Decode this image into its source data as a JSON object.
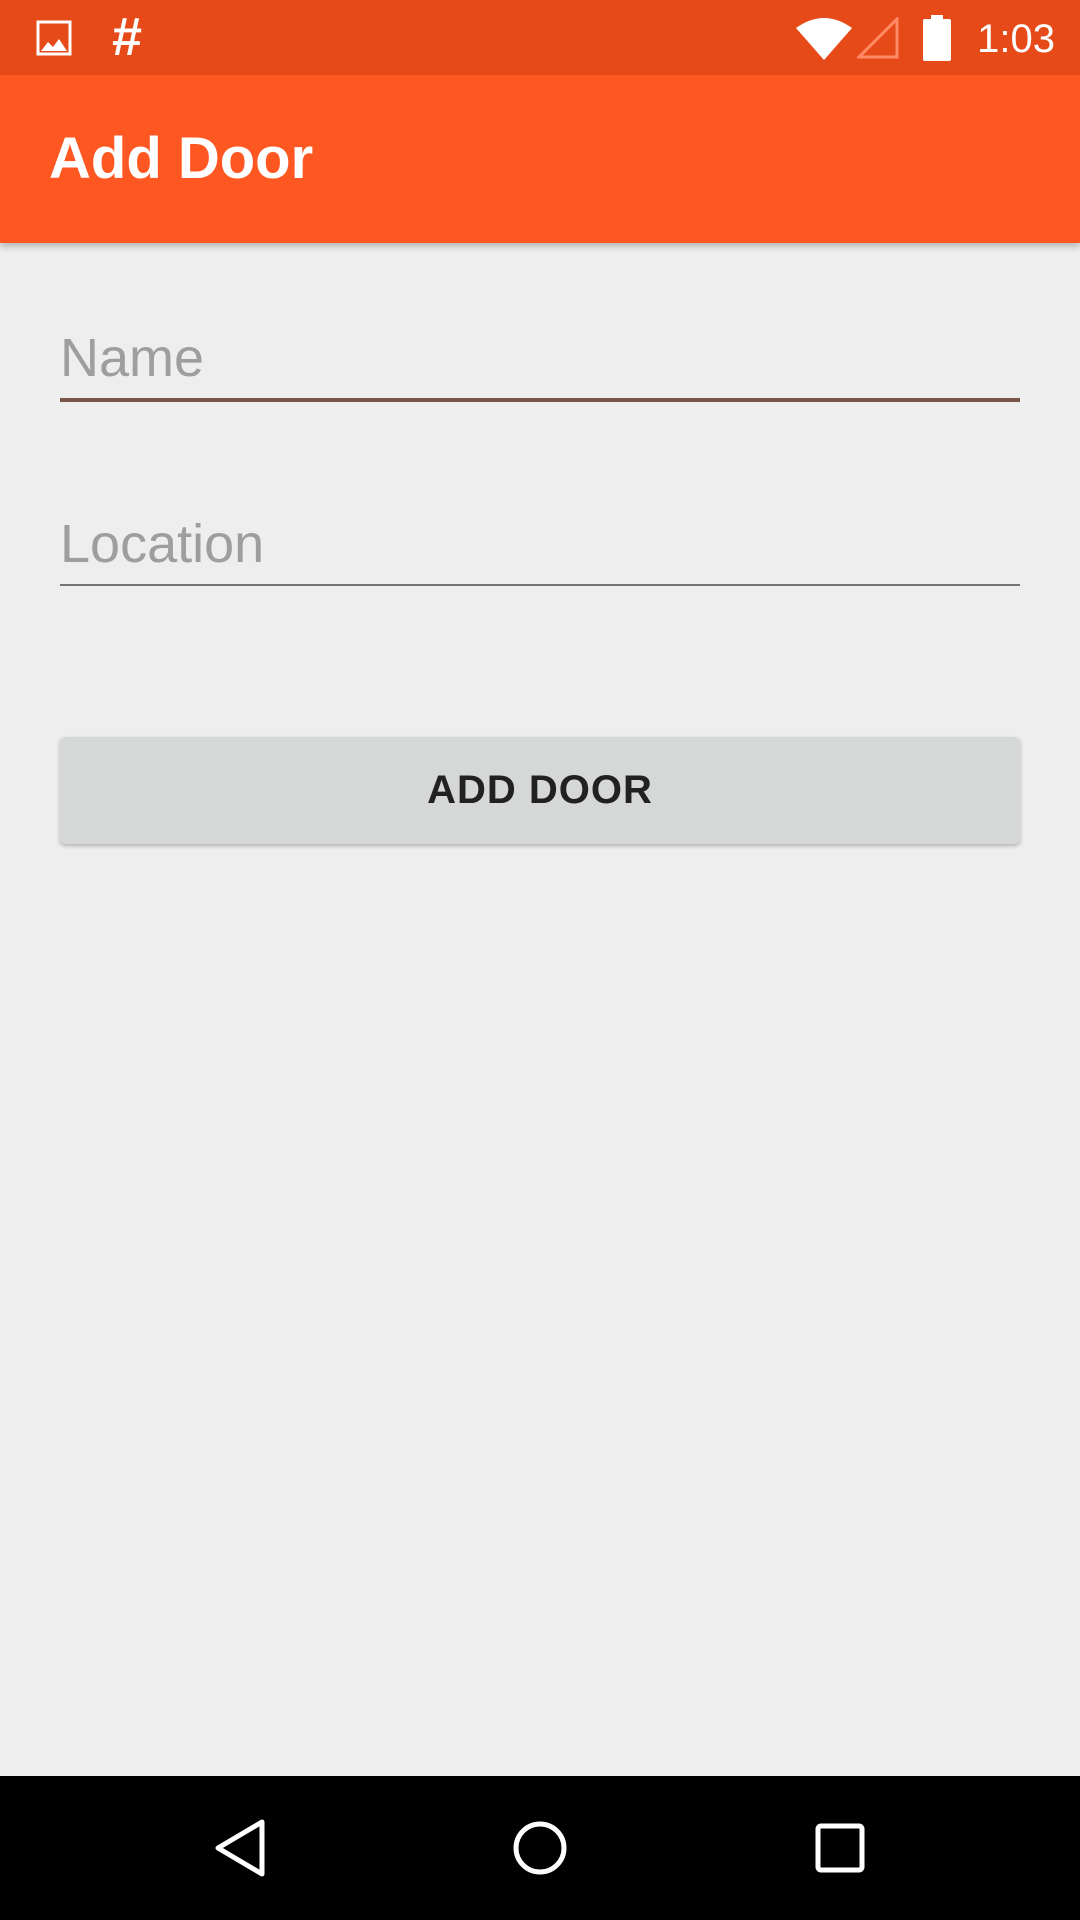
{
  "status_bar": {
    "time": "1:03",
    "hash_symbol": "#",
    "icons": [
      "image-notification-icon",
      "hash-notification-icon",
      "wifi-icon",
      "cell-signal-icon",
      "battery-icon"
    ],
    "background_color": "#E64A19"
  },
  "app_bar": {
    "title": "Add Door",
    "background_color": "#FF5722"
  },
  "form": {
    "name": {
      "placeholder": "Name",
      "value": ""
    },
    "location": {
      "placeholder": "Location",
      "value": ""
    },
    "submit_label": "ADD DOOR"
  },
  "nav_bar": {
    "icons": [
      "back-icon",
      "home-icon",
      "recents-icon"
    ]
  },
  "colors": {
    "accent": "#795548",
    "screen_background": "#EEEEEE",
    "button_background": "#D6D7D7"
  }
}
